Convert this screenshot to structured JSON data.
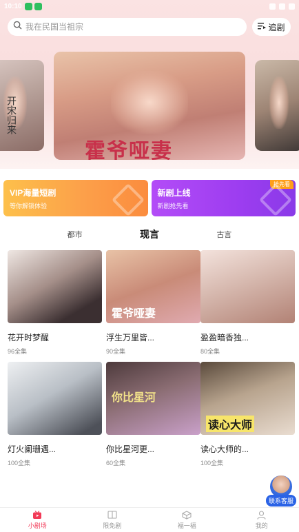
{
  "status_bar": {
    "time": "10:10"
  },
  "search": {
    "placeholder": "我在民国当祖宗"
  },
  "header": {
    "follow_label": "追剧"
  },
  "banner": {
    "main_poster_title": "霍爷哑妻",
    "left_poster_side_text": "开宋归来"
  },
  "promos": [
    {
      "title": "VIP海量短剧",
      "subtitle": "等你解锁体验"
    },
    {
      "title": "新剧上线",
      "subtitle": "新剧抢先看",
      "badge": "抢先看"
    }
  ],
  "tabs": [
    {
      "label": "都市",
      "active": false
    },
    {
      "label": "现言",
      "active": true
    },
    {
      "label": "古言",
      "active": false
    }
  ],
  "dramas": [
    {
      "title": "花开时梦醒",
      "episodes": "96全集",
      "overlay": ""
    },
    {
      "title": "浮生万里皆...",
      "episodes": "90全集",
      "overlay": "霍爷哑妻"
    },
    {
      "title": "盈盈暗香独...",
      "episodes": "80全集",
      "overlay": ""
    },
    {
      "title": "灯火阑珊遇...",
      "episodes": "100全集",
      "overlay": ""
    },
    {
      "title": "你比星河更...",
      "episodes": "60全集",
      "overlay": "你比星河"
    },
    {
      "title": "读心大师的...",
      "episodes": "100全集",
      "overlay": "读心大师"
    }
  ],
  "customer_service": {
    "label": "联系客服"
  },
  "bottom_nav": [
    {
      "label": "小剧场",
      "icon": "theater-icon",
      "active": true
    },
    {
      "label": "限免剧",
      "icon": "book-icon",
      "active": false
    },
    {
      "label": "福一福",
      "icon": "gift-icon",
      "active": false
    },
    {
      "label": "我的",
      "icon": "person-icon",
      "active": false
    }
  ],
  "colors": {
    "accent": "#f23a57",
    "vip_gradient_start": "#fdc04b",
    "new_gradient_start": "#b34cf7"
  }
}
